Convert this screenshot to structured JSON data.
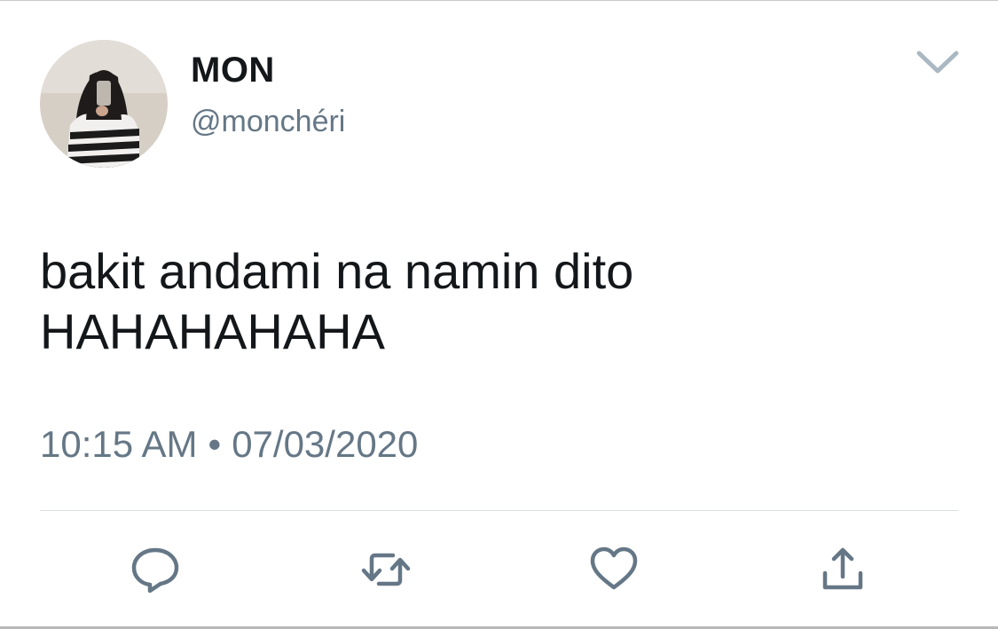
{
  "tweet": {
    "display_name": "MON",
    "handle": "@monchéri",
    "text": "bakit andami na namin dito\nHAHAHAHAHA",
    "time": "10:15 AM",
    "separator": "•",
    "date": "07/03/2020"
  },
  "icons": {
    "menu": "chevron-down-icon",
    "reply": "reply-icon",
    "retweet": "retweet-icon",
    "like": "heart-icon",
    "share": "share-icon"
  },
  "colors": {
    "text_primary": "#14171a",
    "text_secondary": "#657786",
    "icon": "#657786",
    "divider": "#dadde0"
  }
}
